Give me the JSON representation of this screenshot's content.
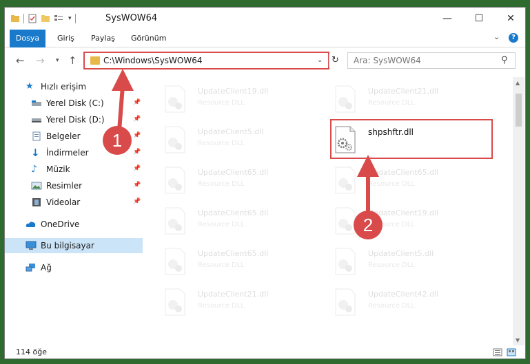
{
  "window": {
    "title": "SysWOW64",
    "controls": {
      "minimize": "—",
      "maximize": "☐",
      "close": "✕"
    }
  },
  "ribbon": {
    "tabs": [
      {
        "label": "Dosya"
      },
      {
        "label": "Giriş"
      },
      {
        "label": "Paylaş"
      },
      {
        "label": "Görünüm"
      }
    ],
    "help": "?"
  },
  "nav": {
    "address": "C:\\Windows\\SysWOW64",
    "search_placeholder": "Ara: SysWOW64"
  },
  "sidebar": {
    "items": [
      {
        "label": "Hızlı erişim",
        "icon": "star-icon"
      },
      {
        "label": "Yerel Disk (C:)",
        "icon": "drive-icon",
        "pinned": true
      },
      {
        "label": "Yerel Disk (D:)",
        "icon": "drive-icon",
        "pinned": true
      },
      {
        "label": "Belgeler",
        "icon": "documents-icon",
        "pinned": true
      },
      {
        "label": "İndirmeler",
        "icon": "download-icon",
        "pinned": true
      },
      {
        "label": "Müzik",
        "icon": "music-icon",
        "pinned": true
      },
      {
        "label": "Resimler",
        "icon": "pictures-icon",
        "pinned": true
      },
      {
        "label": "Videolar",
        "icon": "video-icon",
        "pinned": true
      },
      {
        "label": "OneDrive",
        "icon": "cloud-icon"
      },
      {
        "label": "Bu bilgisayar",
        "icon": "computer-icon",
        "selected": true
      },
      {
        "label": "Ağ",
        "icon": "network-icon"
      }
    ]
  },
  "files": {
    "left": [
      {
        "name": "UpdateClient19.dll",
        "type": "Resource DLL"
      },
      {
        "name": "UpdateClient5.dll",
        "type": "Resource DLL"
      },
      {
        "name": "UpdateClient65.dll",
        "type": "Resource DLL"
      },
      {
        "name": "UpdateClient65.dll",
        "type": "Resource DLL"
      },
      {
        "name": "UpdateClient65.dll",
        "type": "Resource DLL"
      },
      {
        "name": "UpdateClient21.dll",
        "type": "Resource DLL"
      }
    ],
    "right": [
      {
        "name": "UpdateClient21.dll",
        "type": "Resource DLL"
      },
      {
        "name": "shpshftr.dll",
        "type": "",
        "highlight": true
      },
      {
        "name": "UpdateClient65.dll",
        "type": "Resource DLL"
      },
      {
        "name": "UpdateClient19.dll",
        "type": "Resource DLL"
      },
      {
        "name": "UpdateClient5.dll",
        "type": "Resource DLL"
      },
      {
        "name": "UpdateClient42.dll",
        "type": "Resource DLL"
      }
    ]
  },
  "status": {
    "count": "114 öğe"
  },
  "annotations": {
    "step1": "1",
    "step2": "2"
  },
  "colors": {
    "accent": "#1979ca",
    "annotation": "#d94a4a",
    "selection": "#cce4f7"
  }
}
